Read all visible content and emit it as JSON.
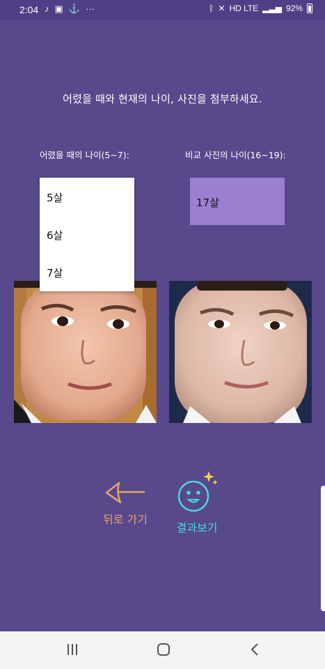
{
  "status_bar": {
    "time": "2:04",
    "left_icons": [
      "music-note-icon",
      "image-icon",
      "alert-icon",
      "more-icon"
    ],
    "net_label": "HD LTE",
    "battery": "92%"
  },
  "main": {
    "title": "어렸을 때와 현재의 나이, 사진을 첨부하세요.",
    "left_label": "어렸을 때의 나이(5~7):",
    "right_label": "비교 사진의 나이(16~19):",
    "young_age_options": [
      "5살",
      "6살",
      "7살"
    ],
    "compare_age_value": "17살"
  },
  "actions": {
    "back_label": "뒤로 가기",
    "result_label": "결과보기"
  },
  "colors": {
    "background": "#58488c",
    "selected_box": "#9b7fd1",
    "back_accent": "#e7a46a",
    "result_accent": "#49d8e6"
  }
}
